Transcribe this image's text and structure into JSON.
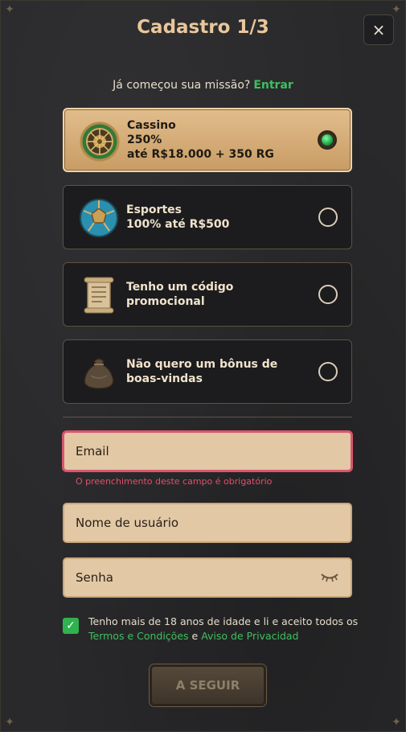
{
  "title": "Cadastro 1/3",
  "close_label": "×",
  "login_prompt": {
    "text": "Já começou sua missão?",
    "link": "Entrar"
  },
  "options": [
    {
      "line1": "Cassino",
      "line2": "250%",
      "line3": "até R$18.000 + 350 RG",
      "selected": true,
      "icon": "roulette-icon"
    },
    {
      "line1": "Esportes",
      "line2": "100% até R$500",
      "selected": false,
      "icon": "soccer-ball-icon"
    },
    {
      "line1": "Tenho um código promocional",
      "selected": false,
      "icon": "scroll-icon"
    },
    {
      "line1": "Não quero um bônus de boas-vindas",
      "selected": false,
      "icon": "sack-icon"
    }
  ],
  "fields": {
    "email_placeholder": "Email",
    "email_error": "O preenchimento deste campo é obrigatório",
    "username_placeholder": "Nome de usuário",
    "password_placeholder": "Senha",
    "password_icon": "eye-closed-icon"
  },
  "terms": {
    "checked": true,
    "text": "Tenho mais de 18 anos de idade e li e aceito todos os",
    "link1": "Termos e Condições",
    "conj": "e",
    "link2": "Aviso de Privacidad"
  },
  "submit_label": "A SEGUIR",
  "colors": {
    "accent": "#3fbf5f",
    "gold": "#e8c79b",
    "error": "#e0506c"
  }
}
